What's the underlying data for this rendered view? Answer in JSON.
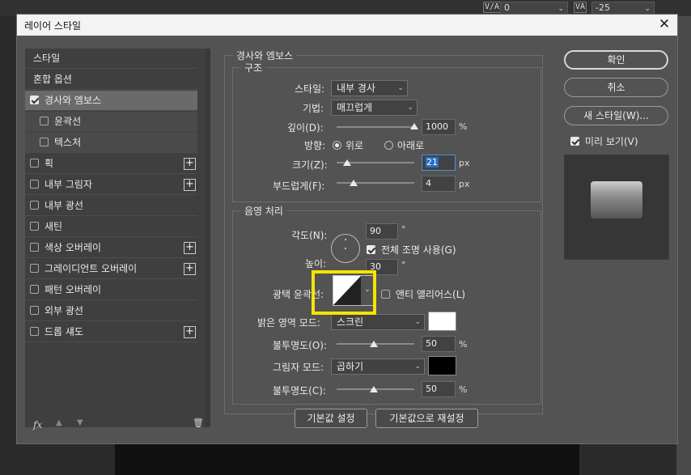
{
  "toolbar": {
    "va_icon_1": "V/A",
    "va_value_1": "0",
    "va_icon_2": "VA",
    "va_value_2": "-25"
  },
  "dialog": {
    "title": "레이어 스타일",
    "close_glyph": "✕"
  },
  "sidebar": {
    "items": [
      {
        "label": "스타일"
      },
      {
        "label": "혼합 옵션"
      },
      {
        "label": "경사와 엠보스",
        "checked": true
      },
      {
        "label": "윤곽선"
      },
      {
        "label": "텍스처"
      },
      {
        "label": "획"
      },
      {
        "label": "내부 그림자"
      },
      {
        "label": "내부 광선"
      },
      {
        "label": "새틴"
      },
      {
        "label": "색상 오버레이"
      },
      {
        "label": "그레이디언트 오버레이"
      },
      {
        "label": "패턴 오버레이"
      },
      {
        "label": "외부 광선"
      },
      {
        "label": "드롭 섀도"
      }
    ],
    "plus_glyph": "+",
    "footer": {
      "fx_label": "fx",
      "up_glyph": "▲",
      "down_glyph": "▼",
      "trash_glyph": "🗑"
    }
  },
  "bevel": {
    "section_title": "경사와 엠보스",
    "structure": {
      "legend": "구조",
      "style_label": "스타일:",
      "style_value": "내부 경사",
      "technique_label": "기법:",
      "technique_value": "매끄럽게",
      "depth_label": "깊이(D):",
      "depth_value": "1000",
      "depth_unit": "%",
      "direction_label": "방향:",
      "dir_up": "위로",
      "dir_down": "아래로",
      "size_label": "크기(Z):",
      "size_value": "21",
      "size_unit": "px",
      "soften_label": "부드럽게(F):",
      "soften_value": "4",
      "soften_unit": "px"
    },
    "shading": {
      "legend": "음영 처리",
      "angle_label": "각도(N):",
      "angle_value": "90",
      "degree": "°",
      "global_light": "전체 조명 사용(G)",
      "altitude_label": "높이:",
      "altitude_value": "30",
      "gloss_label": "광택 윤곽선:",
      "anti_alias": "앤티 앨리어스(L)",
      "highlight_mode_label": "밝은 영역 모드:",
      "highlight_mode_value": "스크린",
      "highlight_color": "#ffffff",
      "highlight_opacity_label": "불투명도(O):",
      "highlight_opacity_value": "50",
      "shadow_mode_label": "그림자 모드:",
      "shadow_mode_value": "곱하기",
      "shadow_color": "#000000",
      "shadow_opacity_label": "불투명도(C):",
      "shadow_opacity_value": "50",
      "pct": "%"
    },
    "make_default": "기본값 설정",
    "reset_default": "기본값으로 재설정"
  },
  "actions": {
    "ok": "확인",
    "cancel": "취소",
    "new_style": "새 스타일(W)...",
    "preview_label": "미리 보기(V)"
  }
}
